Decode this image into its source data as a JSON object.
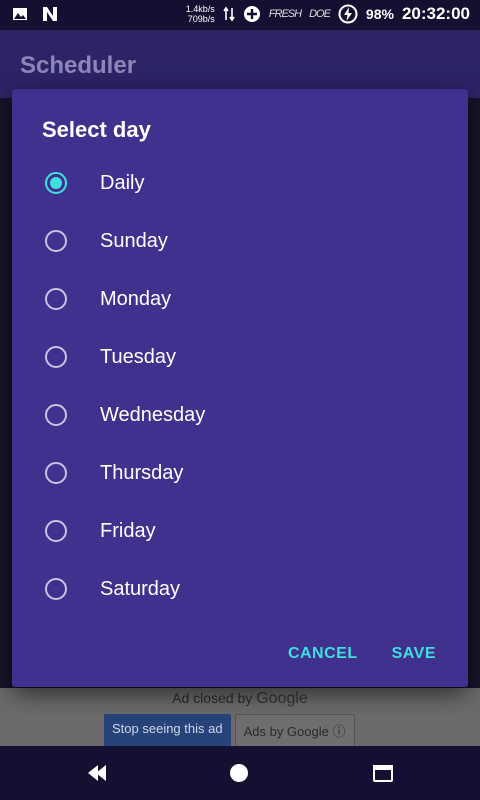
{
  "status_bar": {
    "net_up": "1.4kb/s",
    "net_down": "709b/s",
    "scribble_1": "FRESH",
    "scribble_2": "DOE",
    "battery": "98%",
    "time": "20:32:00",
    "icons": [
      "image-icon",
      "n-logo-icon",
      "data-transfer-icon",
      "plus-circle-icon",
      "battery-saver-icon"
    ]
  },
  "app_bar": {
    "title": "Scheduler"
  },
  "dialog": {
    "title": "Select day",
    "selected_index": 0,
    "options": [
      {
        "label": "Daily",
        "checked": true
      },
      {
        "label": "Sunday",
        "checked": false
      },
      {
        "label": "Monday",
        "checked": false
      },
      {
        "label": "Tuesday",
        "checked": false
      },
      {
        "label": "Wednesday",
        "checked": false
      },
      {
        "label": "Thursday",
        "checked": false
      },
      {
        "label": "Friday",
        "checked": false
      },
      {
        "label": "Saturday",
        "checked": false
      }
    ],
    "cancel_label": "CANCEL",
    "save_label": "SAVE"
  },
  "ad": {
    "closed_text": "Ad closed by",
    "google": "Google",
    "stop_label": "Stop seeing this ad",
    "by_label": "Ads by Google",
    "info_icon": "info-icon"
  },
  "nav_bar": {
    "icons": [
      "back-icon",
      "home-icon",
      "recents-icon"
    ]
  },
  "colors": {
    "dialog_bg": "#41318f",
    "accent": "#3ce0dd",
    "app_bar": "#2d2468",
    "status_bar": "#131031"
  }
}
